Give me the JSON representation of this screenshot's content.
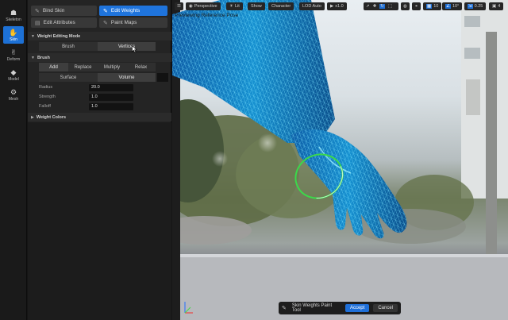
{
  "left_toolbar": {
    "items": [
      {
        "label": "Skeleton",
        "icon": "skeleton-icon",
        "glyph": "☗"
      },
      {
        "label": "Skin",
        "icon": "skin-icon",
        "glyph": "✋"
      },
      {
        "label": "Deform",
        "icon": "deform-icon",
        "glyph": "✌"
      },
      {
        "label": "Model",
        "icon": "model-icon",
        "glyph": "◆"
      },
      {
        "label": "Mesh",
        "icon": "mesh-icon",
        "glyph": "⚙"
      }
    ],
    "active": "Skin"
  },
  "tool_buttons": [
    {
      "label": "Bind Skin",
      "glyph": "✎",
      "active": false
    },
    {
      "label": "Edit Weights",
      "glyph": "✎",
      "active": true
    },
    {
      "label": "Edit Attributes",
      "glyph": "▤",
      "active": false
    },
    {
      "label": "Paint Maps",
      "glyph": "✎",
      "active": false
    }
  ],
  "weight_editing_mode": {
    "title": "Weight Editing Mode",
    "options": [
      "Brush",
      "Vertices"
    ],
    "selected": "Vertices"
  },
  "brush": {
    "title": "Brush",
    "operations": [
      "Add",
      "Replace",
      "Multiply",
      "Relax"
    ],
    "selected_operation": "Add",
    "falloff_modes": [
      "Surface",
      "Volume"
    ],
    "selected_falloff_mode": "Volume",
    "properties": [
      {
        "label": "Radius",
        "value": "20.0"
      },
      {
        "label": "Strength",
        "value": "1.0"
      },
      {
        "label": "Falloff",
        "value": "1.0"
      }
    ]
  },
  "weight_colors": {
    "title": "Weight Colors"
  },
  "viewport": {
    "toolbar": {
      "perspective": "Perspective",
      "lit": "Lit",
      "show": "Show",
      "character": "Character",
      "lod": "LOD Auto",
      "play_speed": "x1.0",
      "grid_snap": "10",
      "rot_snap": "10°",
      "scale_snap": "0.25",
      "cam_speed": "4"
    },
    "preview_label": "Previewing Reference Pose"
  },
  "bottom_bar": {
    "label": "Skin Weights Paint Tool",
    "accept": "Accept",
    "cancel": "Cancel"
  },
  "colors": {
    "accent": "#1f74dc",
    "wireframe": "#36c7f4",
    "brush_ring": "#3bd94a"
  }
}
